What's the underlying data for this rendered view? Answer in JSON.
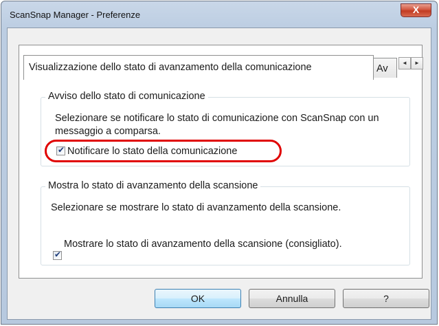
{
  "window": {
    "title": "ScanSnap Manager - Preferenze",
    "close_glyph": "X"
  },
  "tabs": [
    {
      "label": "Visualizzazione dello stato di avanzamento della comunicazione",
      "active": true
    },
    {
      "label": "Av",
      "active": false
    }
  ],
  "tab_scroll": {
    "left_glyph": "◄",
    "right_glyph": "►"
  },
  "group_notify": {
    "legend": "Avviso dello stato di comunicazione",
    "description": "Selezionare se notificare lo stato di comunicazione con ScanSnap con un messaggio a comparsa.",
    "checkbox_label": "Notificare lo stato della comunicazione",
    "checked": true,
    "highlight_color": "#e00000"
  },
  "group_progress": {
    "legend": "Mostra lo stato di avanzamento della scansione",
    "description": "Selezionare se mostrare lo stato di avanzamento della scansione.",
    "checkbox_label": "Mostrare lo stato di avanzamento della scansione (consigliato).",
    "checked": true
  },
  "buttons": {
    "ok": "OK",
    "cancel": "Annulla",
    "help": "?"
  },
  "icons": {
    "close": "close-icon",
    "checkmark": "checkmark-icon",
    "scroll_left": "arrow-left-icon",
    "scroll_right": "arrow-right-icon"
  }
}
